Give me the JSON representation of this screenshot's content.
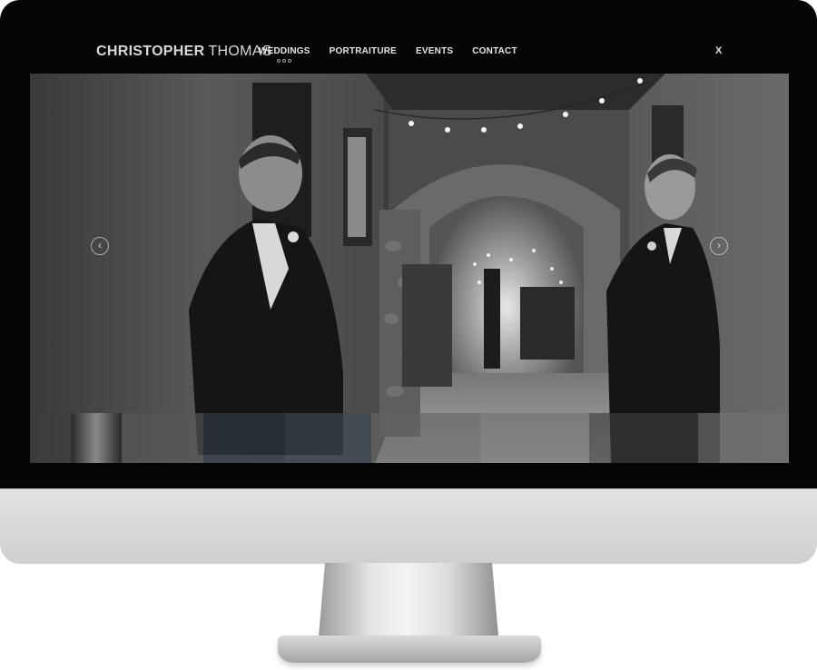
{
  "site": {
    "logo_first": "CHRISTOPHER",
    "logo_last": "THOMAS",
    "close_label": "X"
  },
  "nav": {
    "items": [
      {
        "label": "WEDDINGS",
        "active": true
      },
      {
        "label": "PORTRAITURE",
        "active": false
      },
      {
        "label": "EVENTS",
        "active": false
      },
      {
        "label": "CONTACT",
        "active": false
      }
    ]
  },
  "gallery": {
    "prev_icon": "‹",
    "next_icon": "›",
    "thumb_count": 9,
    "active_thumb": 1
  },
  "colors": {
    "bezel": "#050505",
    "header_text": "#e6e6e6",
    "photo_tone": "grayscale"
  }
}
